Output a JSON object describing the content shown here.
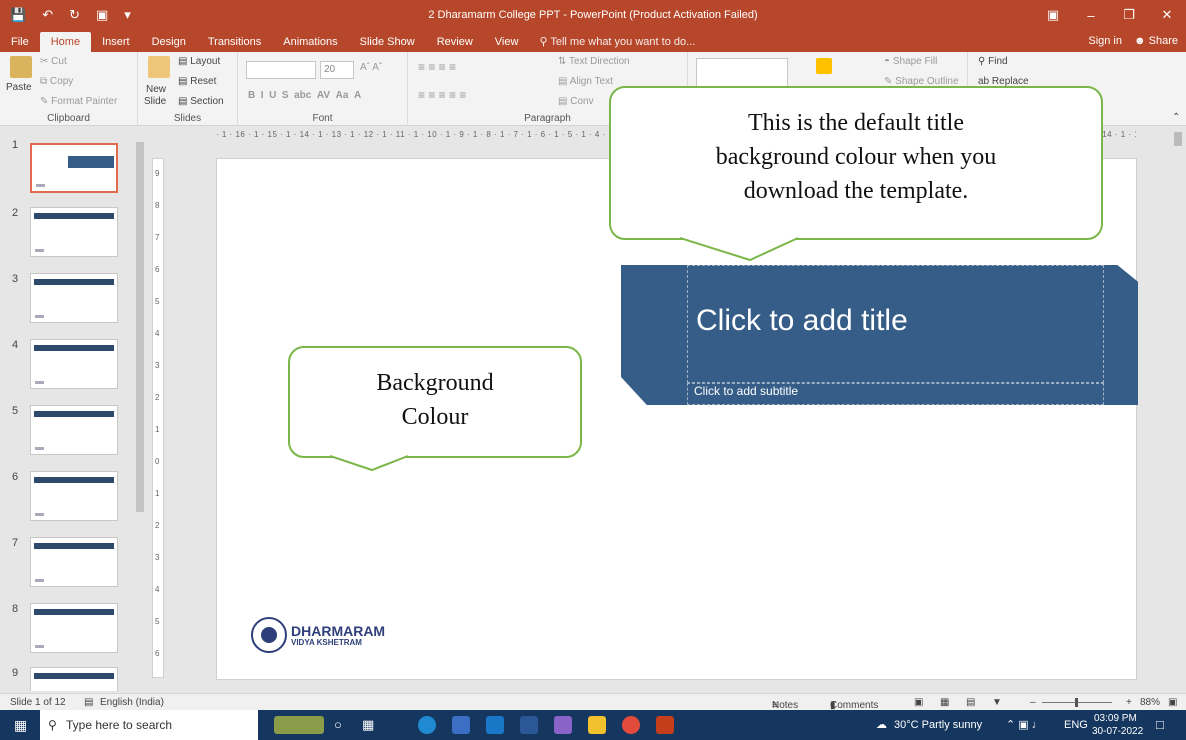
{
  "window": {
    "title": "2 Dharamarm College PPT - PowerPoint (Product Activation Failed)"
  },
  "tabs": [
    "File",
    "Home",
    "Insert",
    "Design",
    "Transitions",
    "Animations",
    "Slide Show",
    "Review",
    "View"
  ],
  "active_tab": "Home",
  "tell_me": "Tell me what you want to do...",
  "account": {
    "sign_in": "Sign in",
    "share": "Share"
  },
  "ribbon": {
    "clipboard": {
      "label": "Clipboard",
      "paste": "Paste",
      "cut": "Cut",
      "copy": "Copy",
      "format_painter": "Format Painter"
    },
    "slides": {
      "label": "Slides",
      "new_slide_1": "New",
      "new_slide_2": "Slide",
      "layout": "Layout",
      "reset": "Reset",
      "section": "Section"
    },
    "font": {
      "label": "Font",
      "size": "20"
    },
    "paragraph": {
      "label": "Paragraph",
      "text_direction": "Text Direction",
      "align_text": "Align Text",
      "convert": "Conv"
    },
    "drawing": {
      "shape_fill": "Shape Fill",
      "shape_outline": "Shape Outline"
    },
    "editing": {
      "find": "Find",
      "replace": "Replace"
    }
  },
  "thumbnails": [
    {
      "num": "1"
    },
    {
      "num": "2"
    },
    {
      "num": "3"
    },
    {
      "num": "4"
    },
    {
      "num": "5"
    },
    {
      "num": "6"
    },
    {
      "num": "7"
    },
    {
      "num": "8"
    },
    {
      "num": "9"
    }
  ],
  "slide": {
    "title_placeholder": "Click to add title",
    "subtitle_placeholder": "Click to add subtitle",
    "logo_name": "DHARMARAM",
    "logo_sub": "VIDYA KSHETRAM",
    "title_bg_color": "#355d87"
  },
  "callouts": {
    "title_note_1": "This is the default title",
    "title_note_2": "background colour when you",
    "title_note_3": "download the template.",
    "bg_note_1": "Background",
    "bg_note_2": "Colour"
  },
  "status": {
    "slide_count": "Slide 1 of 12",
    "language": "English (India)",
    "notes": "Notes",
    "comments": "Comments",
    "zoom": "88%"
  },
  "taskbar": {
    "search_placeholder": "Type here to search",
    "weather": "30°C  Partly sunny",
    "lang": "ENG",
    "time": "03:09 PM",
    "date": "30-07-2022"
  },
  "colors": {
    "accent": "#b7472a",
    "callout_border": "#7ab648",
    "taskbar": "#15365f"
  }
}
